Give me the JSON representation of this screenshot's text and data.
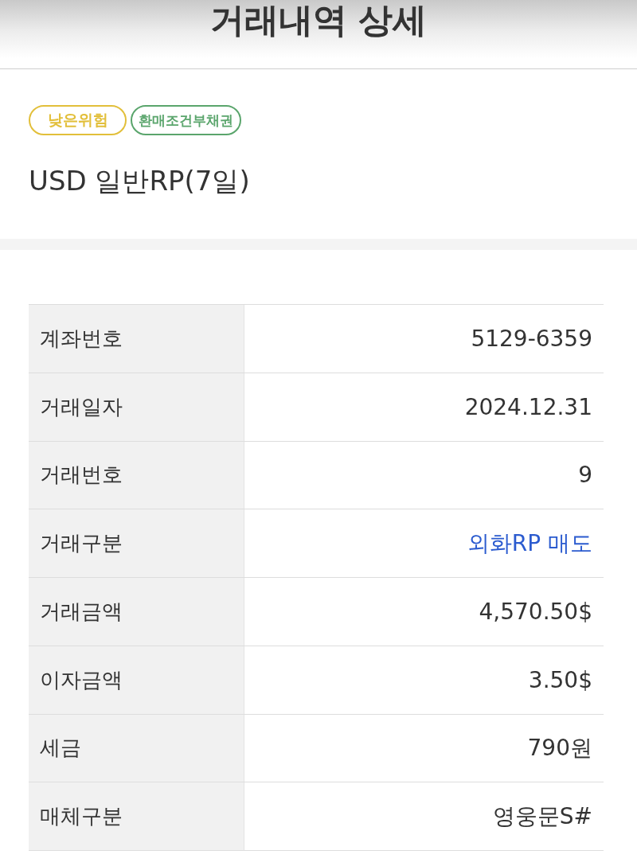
{
  "header": {
    "title": "거래내역 상세"
  },
  "product": {
    "badges": [
      {
        "label": "낮은위험",
        "color": "#e2bf3a"
      },
      {
        "label": "환매조건부채권",
        "color": "#5aa56c"
      }
    ],
    "name": "USD 일반RP(7일)"
  },
  "details": [
    {
      "label": "계좌번호",
      "value": "5129-6359",
      "highlighted": false
    },
    {
      "label": "거래일자",
      "value": "2024.12.31",
      "highlighted": false
    },
    {
      "label": "거래번호",
      "value": "9",
      "highlighted": false
    },
    {
      "label": "거래구분",
      "value": "외화RP 매도",
      "highlighted": true
    },
    {
      "label": "거래금액",
      "value": "4,570.50$",
      "highlighted": false
    },
    {
      "label": "이자금액",
      "value": "3.50$",
      "highlighted": false
    },
    {
      "label": "세금",
      "value": "790원",
      "highlighted": false
    },
    {
      "label": "매체구분",
      "value": "영웅문S#",
      "highlighted": false
    }
  ]
}
